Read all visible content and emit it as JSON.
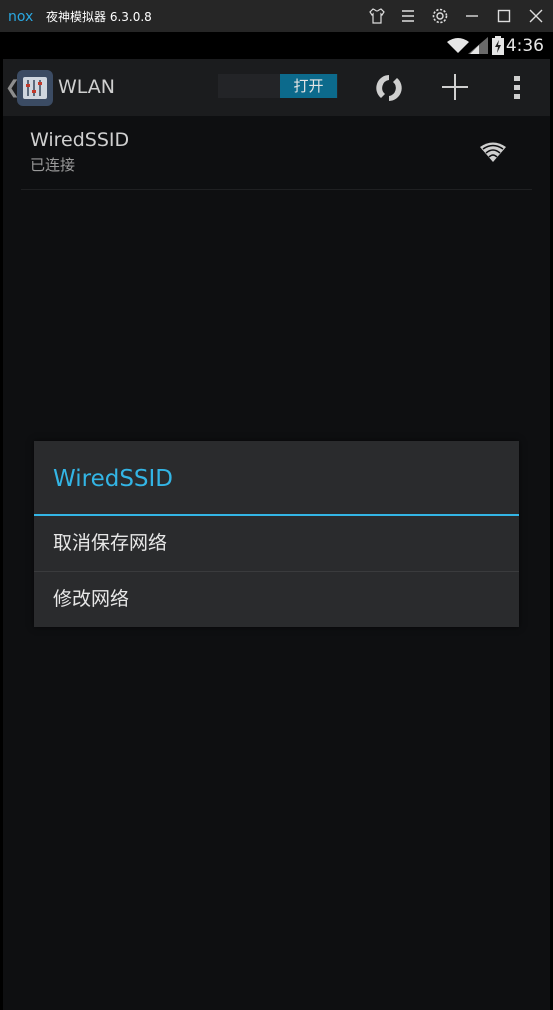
{
  "window": {
    "title": "夜神模拟器 6.3.0.8",
    "logo_text": "nox"
  },
  "status_bar": {
    "time": "4:36"
  },
  "action_bar": {
    "back_glyph": "❮",
    "title": "WLAN",
    "toggle_label": "打开"
  },
  "wifi_list": [
    {
      "ssid": "WiredSSID",
      "status": "已连接"
    }
  ],
  "dialog": {
    "title": "WiredSSID",
    "options": [
      "取消保存网络",
      "修改网络"
    ]
  },
  "colors": {
    "accent": "#33b5e5",
    "toggle_on": "#0c6a8c"
  }
}
